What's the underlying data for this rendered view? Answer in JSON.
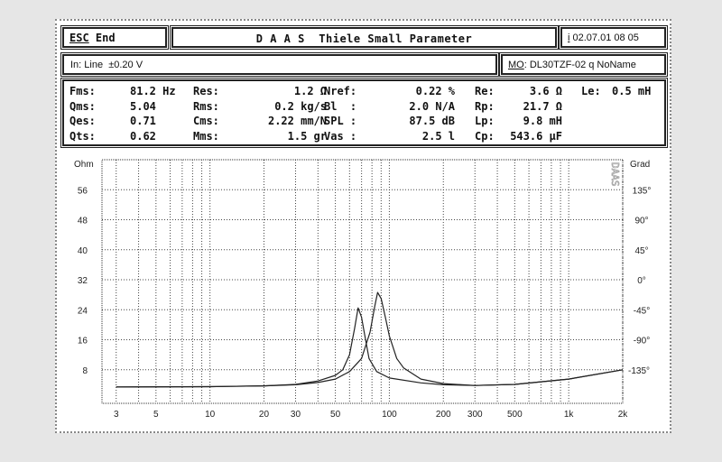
{
  "header": {
    "esc_key": "ESC",
    "esc_label": "End",
    "title": "D A A S  Thiele Small Parameter",
    "info_key": "i",
    "datetime": "02.07.01 08 05"
  },
  "input": {
    "text": "In: Line  ±0.20 V"
  },
  "model": {
    "key": "MO",
    "text": ": DL30TZF-02 q NoName"
  },
  "params": [
    [
      {
        "label": "Fms:",
        "value": "81.2 Hz"
      },
      {
        "label": "Res:",
        "value": "1.2 Ω"
      },
      {
        "label": "Nref:",
        "value": "0.22 %"
      },
      {
        "label": "Re:",
        "value": "3.6 Ω"
      },
      {
        "label": "Le:",
        "value": "0.5 mH"
      }
    ],
    [
      {
        "label": "Qms:",
        "value": "5.04"
      },
      {
        "label": "Rms:",
        "value": "0.2 kg/s"
      },
      {
        "label": "Bl  :",
        "value": "2.0 N/A"
      },
      {
        "label": "Rp:",
        "value": "21.7 Ω"
      }
    ],
    [
      {
        "label": "Qes:",
        "value": "0.71"
      },
      {
        "label": "Cms:",
        "value": "2.22 mm/N"
      },
      {
        "label": "SPL :",
        "value": "87.5 dB"
      },
      {
        "label": "Lp:",
        "value": "9.8 mH"
      }
    ],
    [
      {
        "label": "Qts:",
        "value": "0.62"
      },
      {
        "label": "Mms:",
        "value": "1.5 gr"
      },
      {
        "label": "Vas :",
        "value": "2.5 l"
      },
      {
        "label": "Cp:",
        "value": "543.6 μF"
      }
    ]
  ],
  "chart_data": {
    "type": "line",
    "xscale": "log",
    "xlim": [
      2.5,
      2000
    ],
    "ylim": [
      0,
      64
    ],
    "ylabel": "Ohm",
    "y2label": "Grad",
    "grid": true,
    "xticks": [
      3,
      5,
      10,
      20,
      30,
      50,
      100,
      200,
      300,
      500,
      1000,
      2000
    ],
    "xtick_labels": [
      "3",
      "5",
      "10",
      "20",
      "30",
      "50",
      "100",
      "200",
      "300",
      "500",
      "1k",
      "2k"
    ],
    "yticks": [
      8,
      16,
      24,
      32,
      40,
      48,
      56
    ],
    "y2ticks": [
      "-135°",
      "-90°",
      "-45°",
      "0°",
      "45°",
      "90°",
      "135°"
    ],
    "logo": "DAAS",
    "series": [
      {
        "x": [
          3,
          10,
          20,
          30,
          40,
          50,
          60,
          70,
          78,
          83,
          86,
          90,
          95,
          100,
          110,
          120,
          150,
          200,
          300,
          500,
          1000,
          2000
        ],
        "y": [
          3.4,
          3.5,
          3.7,
          4.0,
          4.6,
          5.5,
          7.5,
          11,
          18,
          25,
          28.6,
          27,
          22,
          17,
          11,
          8.5,
          5.5,
          4.3,
          3.8,
          4.1,
          5.5,
          8.0
        ]
      },
      {
        "x": [
          3,
          10,
          20,
          30,
          40,
          50,
          55,
          60,
          64,
          67,
          70,
          73,
          77,
          85,
          100,
          150,
          200,
          300,
          500,
          1000,
          2000
        ],
        "y": [
          3.4,
          3.5,
          3.7,
          4.1,
          5.0,
          6.5,
          8,
          12,
          19,
          24.5,
          22,
          17,
          11,
          7.5,
          5.8,
          4.5,
          4.0,
          3.8,
          4.1,
          5.5,
          8.0
        ]
      }
    ]
  }
}
